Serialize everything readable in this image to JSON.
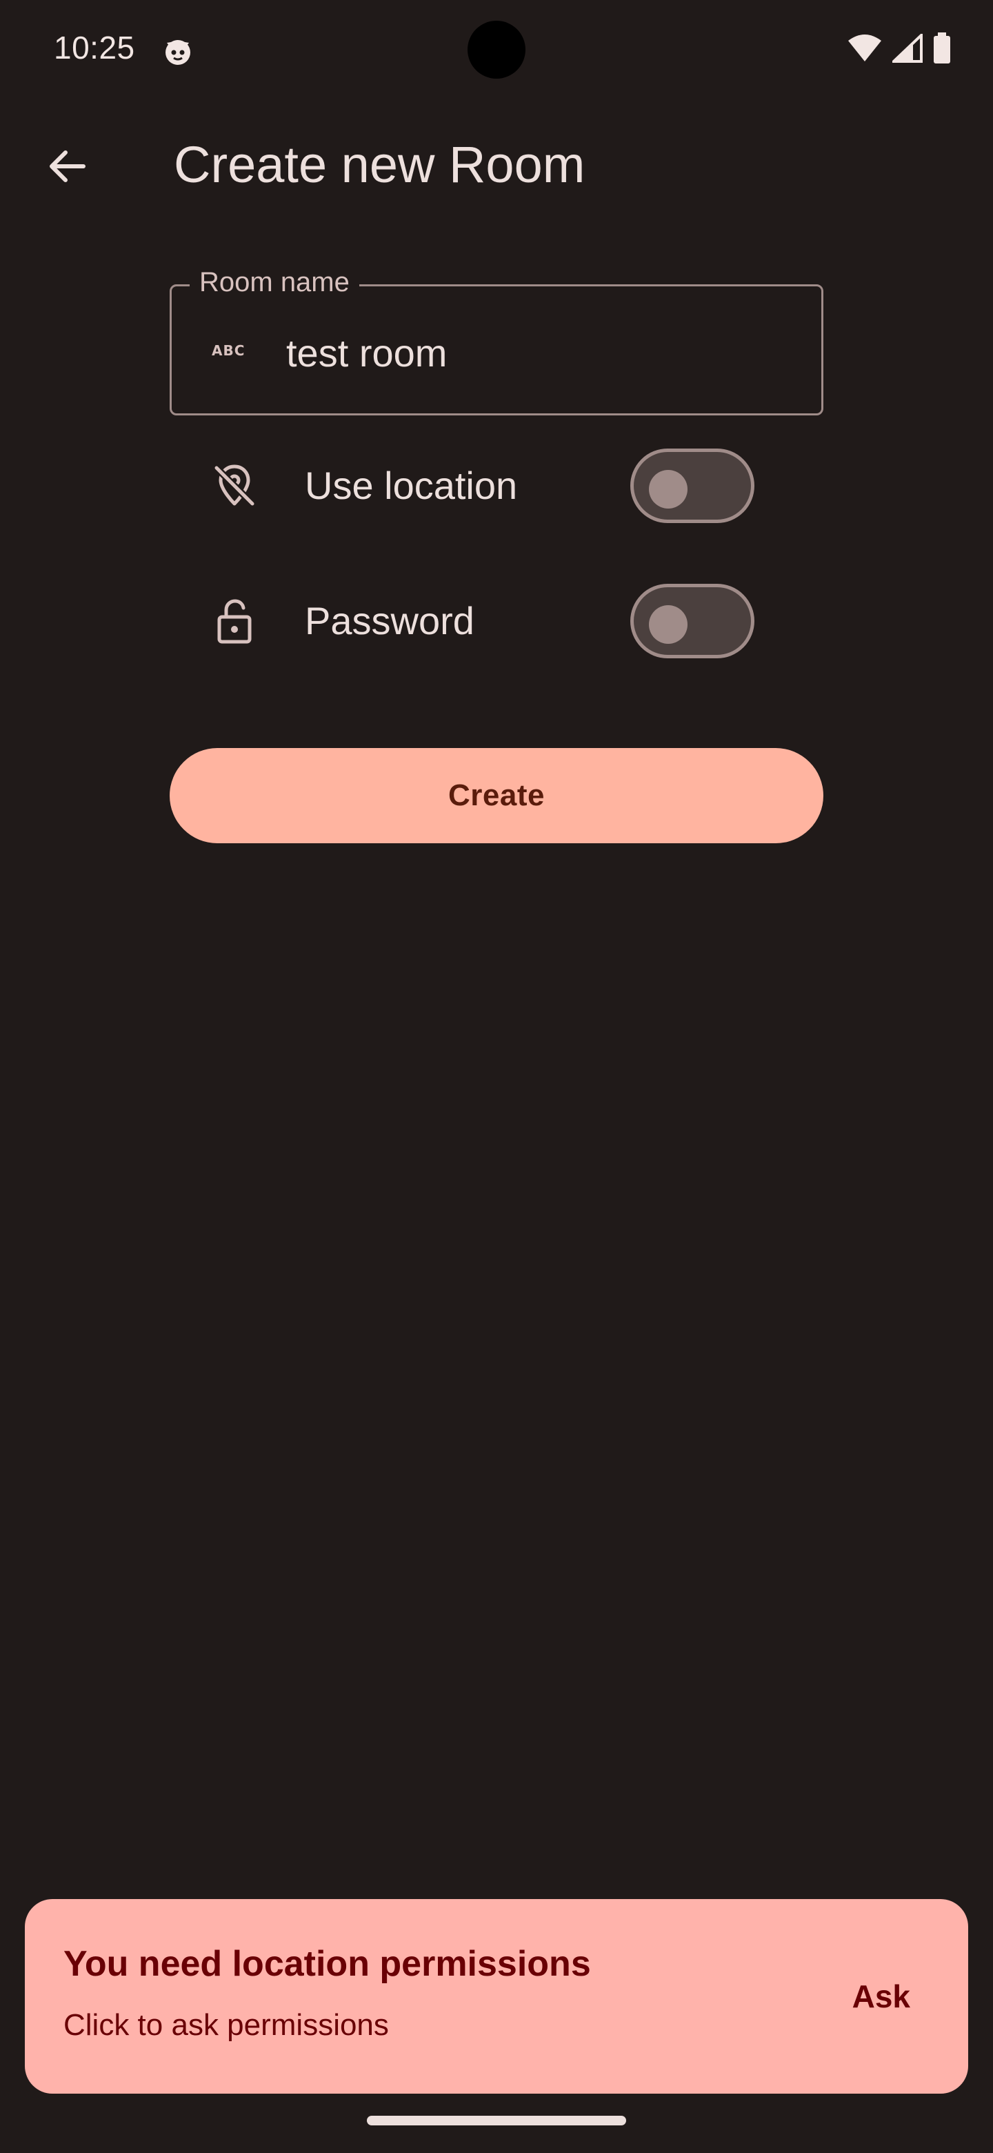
{
  "status_bar": {
    "time": "10:25",
    "notification_icon": "cat-face-icon",
    "icons": [
      "wifi-icon",
      "cellular-signal-icon",
      "battery-icon"
    ]
  },
  "top_bar": {
    "back_icon": "arrow-back-icon",
    "title": "Create new Room"
  },
  "room_name_field": {
    "label": "Room name",
    "icon": "abc-text-icon",
    "value": "test room"
  },
  "options": [
    {
      "icon": "location-off-icon",
      "label": "Use location",
      "enabled": false
    },
    {
      "icon": "lock-icon",
      "label": "Password",
      "enabled": false
    }
  ],
  "create_button": {
    "label": "Create"
  },
  "snackbar": {
    "title": "You need location permissions",
    "subtitle": "Click to ask permissions",
    "action": "Ask"
  },
  "colors": {
    "background": "#201a19",
    "on_surface": "#ede0dd",
    "outline": "#a08c89",
    "primary": "#ffb4a0",
    "on_primary": "#5a1c0c",
    "error_container": "#ffb3ab",
    "on_error_container": "#690005"
  }
}
